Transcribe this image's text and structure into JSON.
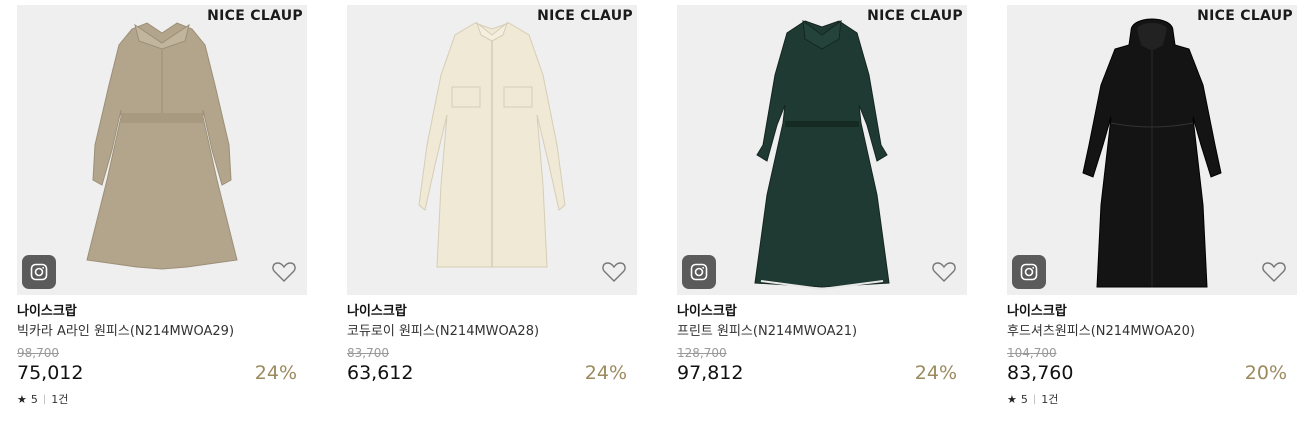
{
  "products": [
    {
      "logo": "NICE CLAUP",
      "brand": "나이스크랍",
      "name": "빅카라 A라인 원피스(N214MWOA29)",
      "original_price": "98,700",
      "sale_price": "75,012",
      "discount": "24%",
      "has_instagram": true,
      "rating": "5",
      "review_count": "1건",
      "color": "#b3a58c",
      "icon_instagram": "instagram-icon",
      "icon_heart": "heart-outline-icon"
    },
    {
      "logo": "NICE CLAUP",
      "brand": "나이스크랍",
      "name": "코듀로이 원피스(N214MWOA28)",
      "original_price": "83,700",
      "sale_price": "63,612",
      "discount": "24%",
      "has_instagram": false,
      "rating": null,
      "review_count": null,
      "color": "#f0e9d6",
      "icon_heart": "heart-outline-icon"
    },
    {
      "logo": "NICE CLAUP",
      "brand": "나이스크랍",
      "name": "프린트 원피스(N214MWOA21)",
      "original_price": "128,700",
      "sale_price": "97,812",
      "discount": "24%",
      "has_instagram": true,
      "rating": null,
      "review_count": null,
      "color": "#1f3a33",
      "icon_instagram": "instagram-icon",
      "icon_heart": "heart-outline-icon"
    },
    {
      "logo": "NICE CLAUP",
      "brand": "나이스크랍",
      "name": "후드셔츠원피스(N214MWOA20)",
      "original_price": "104,700",
      "sale_price": "83,760",
      "discount": "20%",
      "has_instagram": true,
      "rating": "5",
      "review_count": "1건",
      "color": "#141414",
      "icon_instagram": "instagram-icon",
      "icon_heart": "heart-outline-icon"
    }
  ],
  "colors": {
    "discount": "#9c8a5e",
    "image_bg": "#efefef",
    "insta_bg": "#5b5b5b"
  }
}
